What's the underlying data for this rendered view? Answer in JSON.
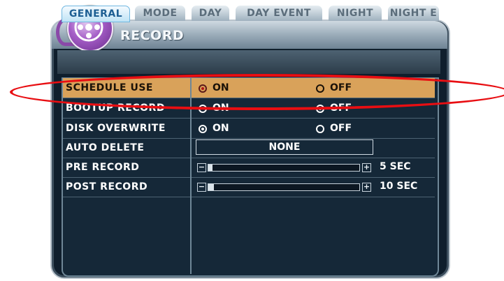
{
  "window": {
    "title": "RECORD"
  },
  "tabs": [
    {
      "label": "GENERAL",
      "active": true
    },
    {
      "label": "MODE",
      "active": false
    },
    {
      "label": "DAY",
      "active": false
    },
    {
      "label": "DAY EVENT",
      "active": false
    },
    {
      "label": "NIGHT",
      "active": false
    },
    {
      "label": "NIGHT E",
      "active": false
    }
  ],
  "rows": {
    "schedule_use": {
      "label": "SCHEDULE USE",
      "on_label": "ON",
      "off_label": "OFF",
      "selected": "ON"
    },
    "bootup_record": {
      "label": "BOOTUP RECORD",
      "on_label": "ON",
      "off_label": "OFF",
      "selected": "OFF"
    },
    "disk_overwrite": {
      "label": "DISK OVERWRITE",
      "on_label": "ON",
      "off_label": "OFF",
      "selected": "ON"
    },
    "auto_delete": {
      "label": "AUTO DELETE",
      "value": "NONE"
    },
    "pre_record": {
      "label": "PRE RECORD",
      "value": "5 SEC",
      "minus": "−",
      "plus": "+",
      "level": 0.02
    },
    "post_record": {
      "label": "POST RECORD",
      "value": "10 SEC",
      "minus": "−",
      "plus": "+",
      "level": 0.03
    }
  },
  "colors": {
    "highlight_row": "#d9a25a",
    "panel_bg": "#152838",
    "annotation": "#e80e12",
    "active_tab_text": "#1d5f93"
  },
  "icons": {
    "logo": "film-reel-icon"
  }
}
